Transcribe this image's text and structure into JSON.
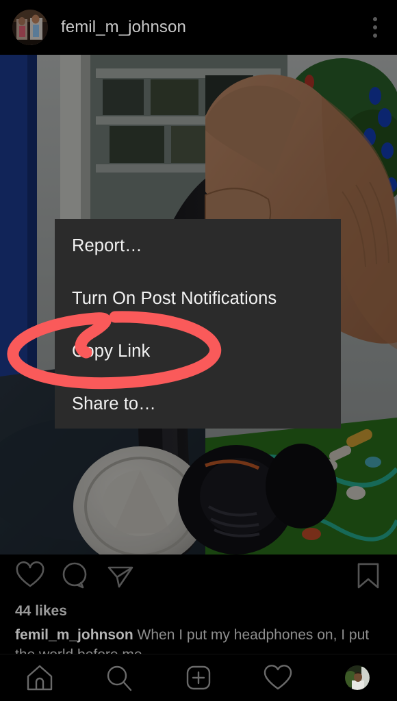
{
  "post": {
    "username": "femil_m_johnson",
    "avatar_icon": "profile-avatar-two-people",
    "options_icon": "more-options-vertical-dots-icon",
    "photo_alt": "hand-holding-black-headphones"
  },
  "dialog": {
    "items": [
      {
        "label": "Report…",
        "name": "report"
      },
      {
        "label": "Turn On Post Notifications",
        "name": "turn-on-post-notifications"
      },
      {
        "label": "Copy Link",
        "name": "copy-link"
      },
      {
        "label": "Share to…",
        "name": "share-to"
      }
    ],
    "background_color": "#2b2b2b",
    "text_color": "#f2f2f2"
  },
  "annotation": {
    "shape": "hand-drawn-ellipse",
    "color": "#fa5a5a",
    "targets": "Copy Link"
  },
  "actions": {
    "like_icon": "heart-icon",
    "comment_icon": "comment-bubble-icon",
    "share_icon": "share-paper-plane-icon",
    "save_icon": "bookmark-icon"
  },
  "engagement": {
    "likes": "44 likes",
    "caption_username": "femil_m_johnson",
    "caption_text": "When I put my headphones on, I",
    "caption_line2": "put the world before me"
  },
  "bottom_nav": [
    {
      "name": "home",
      "icon": "home-icon"
    },
    {
      "name": "search",
      "icon": "search-icon"
    },
    {
      "name": "add-post",
      "icon": "plus-square-icon"
    },
    {
      "name": "activity",
      "icon": "heart-icon"
    },
    {
      "name": "profile",
      "icon": "profile-avatar-icon"
    }
  ],
  "colors": {
    "background": "#000000",
    "dialog": "#2b2b2b",
    "annotation_red": "#fa5a5a",
    "icon_gray": "#555555"
  }
}
